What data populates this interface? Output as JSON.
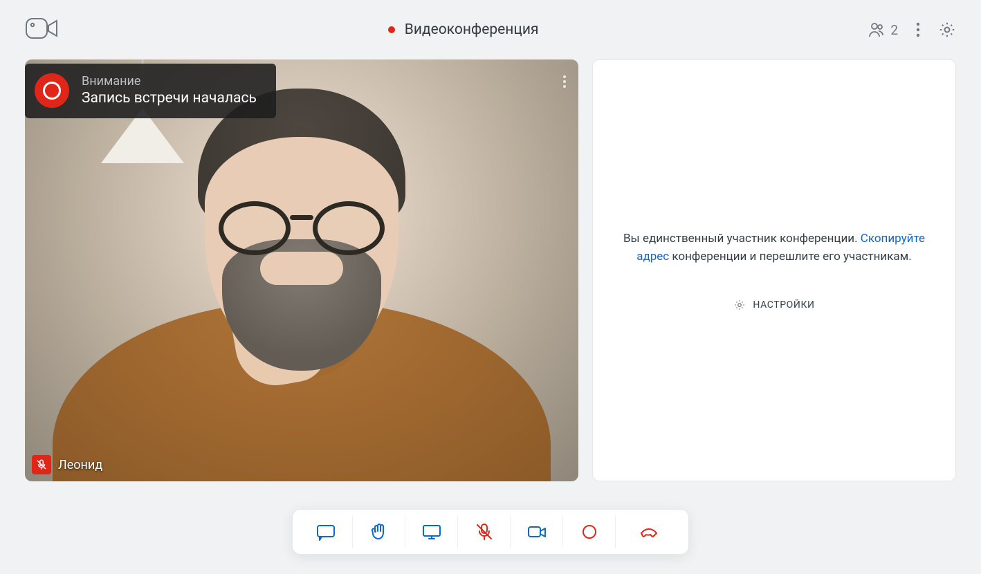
{
  "header": {
    "title": "Видеоконференция",
    "participant_count": "2"
  },
  "notification": {
    "title": "Внимание",
    "message": "Запись встречи началась"
  },
  "video": {
    "participant_name": "Леонид"
  },
  "side_panel": {
    "line_part1": "Вы единственный участник конференции. ",
    "copy_link": "Скопируйте адрес",
    "line_part2": " конференции и перешлите его участникам.",
    "settings_label": "НАСТРОЙКИ"
  }
}
